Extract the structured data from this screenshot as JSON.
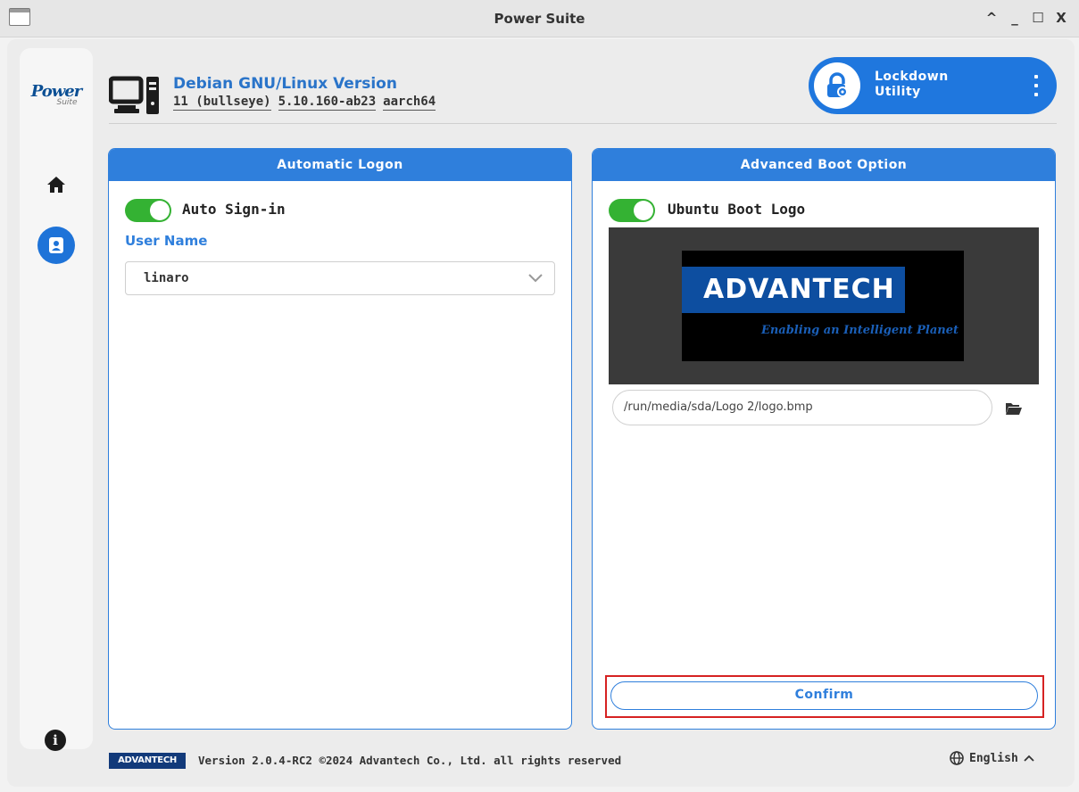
{
  "window": {
    "title": "Power Suite"
  },
  "title_controls": [
    "^",
    "_",
    "☐",
    "X"
  ],
  "sidebar": {
    "brand_main": "Power",
    "brand_sub": "Suite",
    "items": [
      {
        "name": "home",
        "icon": "home-icon",
        "active": false
      },
      {
        "name": "user",
        "icon": "user-card-icon",
        "active": true
      }
    ]
  },
  "header": {
    "os_title": "Debian GNU/Linux Version",
    "os_version": "11 (bullseye)",
    "kernel": "5.10.160-ab23",
    "arch": "aarch64"
  },
  "lockdown": {
    "line1": "Lockdown",
    "line2": "Utility"
  },
  "automatic_logon": {
    "title": "Automatic Logon",
    "toggle_label": "Auto Sign-in",
    "toggle_on": true,
    "user_label": "User Name",
    "user_value": "linaro"
  },
  "advanced_boot": {
    "title": "Advanced Boot Option",
    "toggle_label": "Ubuntu Boot Logo",
    "toggle_on": true,
    "logo_word": "ADVANTECH",
    "logo_tagline": "Enabling an Intelligent Planet",
    "path": "/run/media/sda/Logo 2/logo.bmp",
    "confirm_label": "Confirm"
  },
  "footer": {
    "logo_text": "ADVANTECH",
    "version_text": "Version 2.0.4-RC2 ©2024 Advantech Co., Ltd. all rights reserved",
    "language": "English"
  },
  "colors": {
    "accent": "#2f7fdc",
    "toggle_on": "#34b233",
    "highlight": "#d62222"
  }
}
